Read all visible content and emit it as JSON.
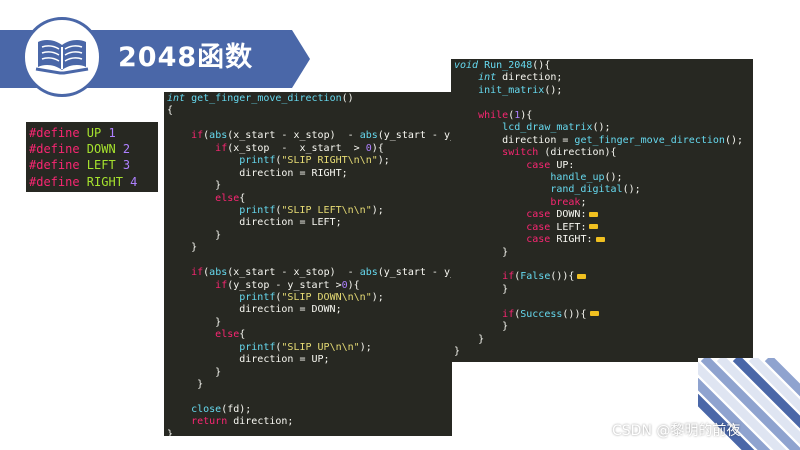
{
  "slide": {
    "title": "2048函数",
    "watermark": "CSDN @黎明的前夜"
  },
  "icons": {
    "title_icon": "open-book-icon",
    "fold_marker": "folded-code-icon"
  },
  "colors": {
    "accent": "#4a67a8",
    "code_bg": "#272822",
    "keyword": "#f92672",
    "function": "#66d9ef",
    "string": "#e6db74",
    "number": "#ae81ff",
    "define_name": "#a6e22e"
  },
  "defines": [
    {
      "kw": "#define",
      "name": "UP",
      "value": "1"
    },
    {
      "kw": "#define",
      "name": "DOWN",
      "value": "2"
    },
    {
      "kw": "#define",
      "name": "LEFT",
      "value": "3"
    },
    {
      "kw": "#define",
      "name": "RIGHT",
      "value": "4"
    }
  ],
  "func_a": [
    [
      [
        "ty",
        "int "
      ],
      [
        "fn",
        "get_finger_move_direction"
      ],
      [
        "",
        "()"
      ]
    ],
    [
      [
        "",
        "{"
      ]
    ],
    [
      [
        "",
        ""
      ]
    ],
    [
      [
        "",
        "    "
      ],
      [
        "kw",
        "if"
      ],
      [
        "",
        "("
      ],
      [
        "fn",
        "abs"
      ],
      [
        "",
        "(x_start - x_stop)  - "
      ],
      [
        "fn",
        "abs"
      ],
      [
        "",
        "(y_start - y_s"
      ]
    ],
    [
      [
        "",
        "        "
      ],
      [
        "kw",
        "if"
      ],
      [
        "",
        "(x_stop  -  x_start  > "
      ],
      [
        "nu",
        "0"
      ],
      [
        "",
        "){"
      ]
    ],
    [
      [
        "",
        "            "
      ],
      [
        "fn",
        "printf"
      ],
      [
        "",
        "("
      ],
      [
        "st",
        "\"SLIP RIGHT\\n\\n\""
      ],
      [
        "",
        ");"
      ]
    ],
    [
      [
        "",
        "            direction = RIGHT;"
      ]
    ],
    [
      [
        "",
        "        }"
      ]
    ],
    [
      [
        "",
        "        "
      ],
      [
        "kw",
        "else"
      ],
      [
        "",
        "{"
      ]
    ],
    [
      [
        "",
        "            "
      ],
      [
        "fn",
        "printf"
      ],
      [
        "",
        "("
      ],
      [
        "st",
        "\"SLIP LEFT\\n\\n\""
      ],
      [
        "",
        ");"
      ]
    ],
    [
      [
        "",
        "            direction = LEFT;"
      ]
    ],
    [
      [
        "",
        "        }"
      ]
    ],
    [
      [
        "",
        "    }"
      ]
    ],
    [
      [
        "",
        ""
      ]
    ],
    [
      [
        "",
        "    "
      ],
      [
        "kw",
        "if"
      ],
      [
        "",
        "("
      ],
      [
        "fn",
        "abs"
      ],
      [
        "",
        "(x_start - x_stop)  - "
      ],
      [
        "fn",
        "abs"
      ],
      [
        "",
        "(y_start - y_s"
      ]
    ],
    [
      [
        "",
        "        "
      ],
      [
        "kw",
        "if"
      ],
      [
        "",
        "(y_stop - y_start >"
      ],
      [
        "nu",
        "0"
      ],
      [
        "",
        "){"
      ]
    ],
    [
      [
        "",
        "            "
      ],
      [
        "fn",
        "printf"
      ],
      [
        "",
        "("
      ],
      [
        "st",
        "\"SLIP DOWN\\n\\n\""
      ],
      [
        "",
        ");"
      ]
    ],
    [
      [
        "",
        "            direction = DOWN;"
      ]
    ],
    [
      [
        "",
        "        }"
      ]
    ],
    [
      [
        "",
        "        "
      ],
      [
        "kw",
        "else"
      ],
      [
        "",
        "{"
      ]
    ],
    [
      [
        "",
        "            "
      ],
      [
        "fn",
        "printf"
      ],
      [
        "",
        "("
      ],
      [
        "st",
        "\"SLIP UP\\n\\n\""
      ],
      [
        "",
        ");"
      ]
    ],
    [
      [
        "",
        "            direction = UP;"
      ]
    ],
    [
      [
        "",
        "        }"
      ]
    ],
    [
      [
        "",
        "     }"
      ]
    ],
    [
      [
        "",
        ""
      ]
    ],
    [
      [
        "",
        "    "
      ],
      [
        "fn",
        "close"
      ],
      [
        "",
        "(fd);"
      ]
    ],
    [
      [
        "",
        "    "
      ],
      [
        "kw",
        "return"
      ],
      [
        "",
        " direction;"
      ]
    ],
    [
      [
        "",
        "}"
      ]
    ]
  ],
  "func_b": [
    [
      [
        "ty",
        "void "
      ],
      [
        "fn",
        "Run_2048"
      ],
      [
        "",
        "(){"
      ]
    ],
    [
      [
        "",
        "    "
      ],
      [
        "ty",
        "int"
      ],
      [
        "",
        " direction;"
      ]
    ],
    [
      [
        "",
        "    "
      ],
      [
        "fn",
        "init_matrix"
      ],
      [
        "",
        "();"
      ]
    ],
    [
      [
        "",
        ""
      ]
    ],
    [
      [
        "",
        "    "
      ],
      [
        "kw",
        "while"
      ],
      [
        "",
        "("
      ],
      [
        "nu",
        "1"
      ],
      [
        "",
        "){"
      ]
    ],
    [
      [
        "",
        "        "
      ],
      [
        "fn",
        "lcd_draw_matrix"
      ],
      [
        "",
        "();"
      ]
    ],
    [
      [
        "",
        "        direction = "
      ],
      [
        "fn",
        "get_finger_move_direction"
      ],
      [
        "",
        "();"
      ]
    ],
    [
      [
        "",
        "        "
      ],
      [
        "kw",
        "switch"
      ],
      [
        "",
        " (direction){"
      ]
    ],
    [
      [
        "",
        "            "
      ],
      [
        "kw",
        "case"
      ],
      [
        "",
        " UP:"
      ]
    ],
    [
      [
        "",
        "                "
      ],
      [
        "fn",
        "handle_up"
      ],
      [
        "",
        "();"
      ]
    ],
    [
      [
        "",
        "                "
      ],
      [
        "fn",
        "rand_digital"
      ],
      [
        "",
        "();"
      ]
    ],
    [
      [
        "",
        "                "
      ],
      [
        "kw",
        "break"
      ],
      [
        "",
        ";"
      ]
    ],
    [
      [
        "",
        "            "
      ],
      [
        "kw",
        "case"
      ],
      [
        "",
        " DOWN:"
      ],
      [
        "fold",
        ""
      ]
    ],
    [
      [
        "",
        "            "
      ],
      [
        "kw",
        "case"
      ],
      [
        "",
        " LEFT:"
      ],
      [
        "fold",
        ""
      ]
    ],
    [
      [
        "",
        "            "
      ],
      [
        "kw",
        "case"
      ],
      [
        "",
        " RIGHT:"
      ],
      [
        "fold",
        ""
      ]
    ],
    [
      [
        "",
        "        }"
      ]
    ],
    [
      [
        "",
        ""
      ]
    ],
    [
      [
        "",
        "        "
      ],
      [
        "kw",
        "if"
      ],
      [
        "",
        "("
      ],
      [
        "fn",
        "False"
      ],
      [
        "",
        "()){"
      ],
      [
        "fold",
        ""
      ]
    ],
    [
      [
        "",
        "        }"
      ]
    ],
    [
      [
        "",
        ""
      ]
    ],
    [
      [
        "",
        "        "
      ],
      [
        "kw",
        "if"
      ],
      [
        "",
        "("
      ],
      [
        "fn",
        "Success"
      ],
      [
        "",
        "()){"
      ],
      [
        "fold",
        ""
      ]
    ],
    [
      [
        "",
        "        }"
      ]
    ],
    [
      [
        "",
        "    }"
      ]
    ],
    [
      [
        "",
        "}"
      ]
    ]
  ]
}
